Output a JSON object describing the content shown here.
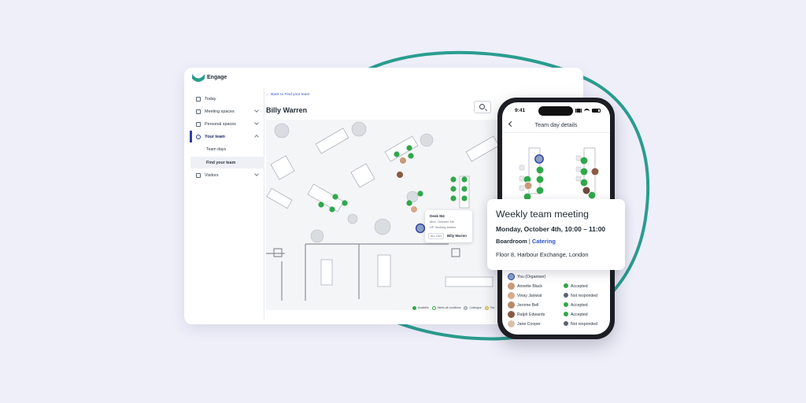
{
  "app": {
    "name": "Engage"
  },
  "colors": {
    "accent": "#2fa84a",
    "brand_teal": "#2a9d8f",
    "nav_active": "#2f3ea8",
    "link": "#2f54c8",
    "background": "#efeffa"
  },
  "sidebar": {
    "items": [
      {
        "label": "Today",
        "icon": "calendar-icon"
      },
      {
        "label": "Meeting spaces",
        "icon": "meeting-icon"
      },
      {
        "label": "Personal spaces",
        "icon": "desk-icon"
      },
      {
        "label": "Your team",
        "icon": "team-icon"
      },
      {
        "label": "Visitors",
        "icon": "visitor-icon"
      }
    ],
    "subitems": [
      {
        "label": "Team days"
      },
      {
        "label": "Find your team"
      }
    ]
  },
  "main": {
    "back_link": "← Back to Find your team",
    "title": "Billy Warren"
  },
  "tooltip": {
    "title": "Desk M4",
    "date": "Mon, October 4th",
    "equipment": "HP docking station",
    "tag": "ALL DAY",
    "name": "Billy Warren"
  },
  "legend": [
    {
      "label": "Available"
    },
    {
      "label": "Meets all conditions"
    },
    {
      "label": "Colleague"
    },
    {
      "label": "Tea"
    }
  ],
  "phone": {
    "time": "9:41",
    "title": "Team day details",
    "attendees": [
      {
        "name": "You (Organiser)",
        "status": ""
      },
      {
        "name": "Annette Black",
        "status": "Accepted"
      },
      {
        "name": "Vinay Jaiswal",
        "status": "Not responded"
      },
      {
        "name": "Jerome Bell",
        "status": "Accepted"
      },
      {
        "name": "Ralph Edwards",
        "status": "Accepted"
      },
      {
        "name": "Jane Cooper",
        "status": "Not responded"
      }
    ]
  },
  "meeting": {
    "title": "Weekly team meeting",
    "when": "Monday, October 4th, 10:00 – 11:00",
    "room": "Boardroom",
    "separator": "|",
    "catering": "Catering",
    "location": "Floor 8, Harbour Exchange, London"
  }
}
